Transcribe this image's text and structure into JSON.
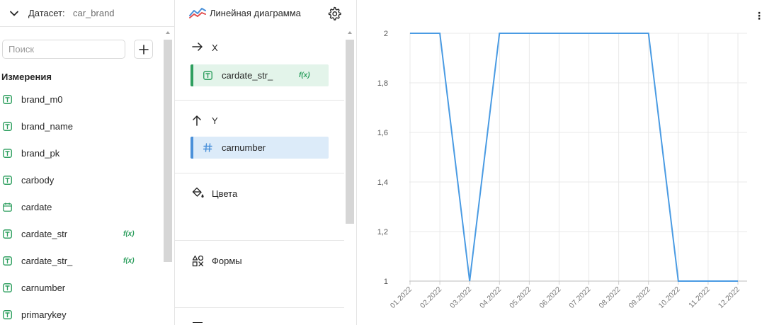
{
  "dataset": {
    "label": "Датасет:",
    "name": "car_brand"
  },
  "search": {
    "placeholder": "Поиск",
    "value": ""
  },
  "dimensions": {
    "title": "Измерения",
    "items": [
      {
        "name": "brand_m0",
        "type": "text",
        "formula": false
      },
      {
        "name": "brand_name",
        "type": "text",
        "formula": false
      },
      {
        "name": "brand_pk",
        "type": "text",
        "formula": false
      },
      {
        "name": "carbody",
        "type": "text",
        "formula": false
      },
      {
        "name": "cardate",
        "type": "date",
        "formula": false
      },
      {
        "name": "cardate_str",
        "type": "text",
        "formula": true
      },
      {
        "name": "cardate_str_",
        "type": "text",
        "formula": true
      },
      {
        "name": "carnumber",
        "type": "text",
        "formula": false
      },
      {
        "name": "primarykey",
        "type": "text",
        "formula": false
      }
    ],
    "formula_badge": "f(x)"
  },
  "visualization": {
    "title": "Линейная диаграмма",
    "sections": {
      "x": {
        "label": "X",
        "field": "cardate_str_",
        "formula_badge": "f(x)"
      },
      "y": {
        "label": "Y",
        "field": "carnumber"
      },
      "colors": {
        "label": "Цвета"
      },
      "shapes": {
        "label": "Формы"
      }
    }
  },
  "colors": {
    "accent_green": "#2e9f5f",
    "chip_green_bg": "#e3f4ea",
    "accent_blue": "#4a90d9",
    "chip_blue_bg": "#dcebf9",
    "line": "#4a9be3"
  },
  "chart_data": {
    "type": "line",
    "x": [
      "01.2022",
      "02.2022",
      "03.2022",
      "04.2022",
      "05.2022",
      "06.2022",
      "07.2022",
      "08.2022",
      "09.2022",
      "10.2022",
      "11.2022",
      "12.2022"
    ],
    "series": [
      {
        "values": [
          2,
          2,
          1,
          2,
          2,
          2,
          2,
          2,
          2,
          1,
          1,
          1
        ]
      }
    ],
    "yticks": [
      "1",
      "1,2",
      "1,4",
      "1,6",
      "1,8",
      "2"
    ],
    "ylim": [
      1,
      2
    ],
    "grid": true
  }
}
